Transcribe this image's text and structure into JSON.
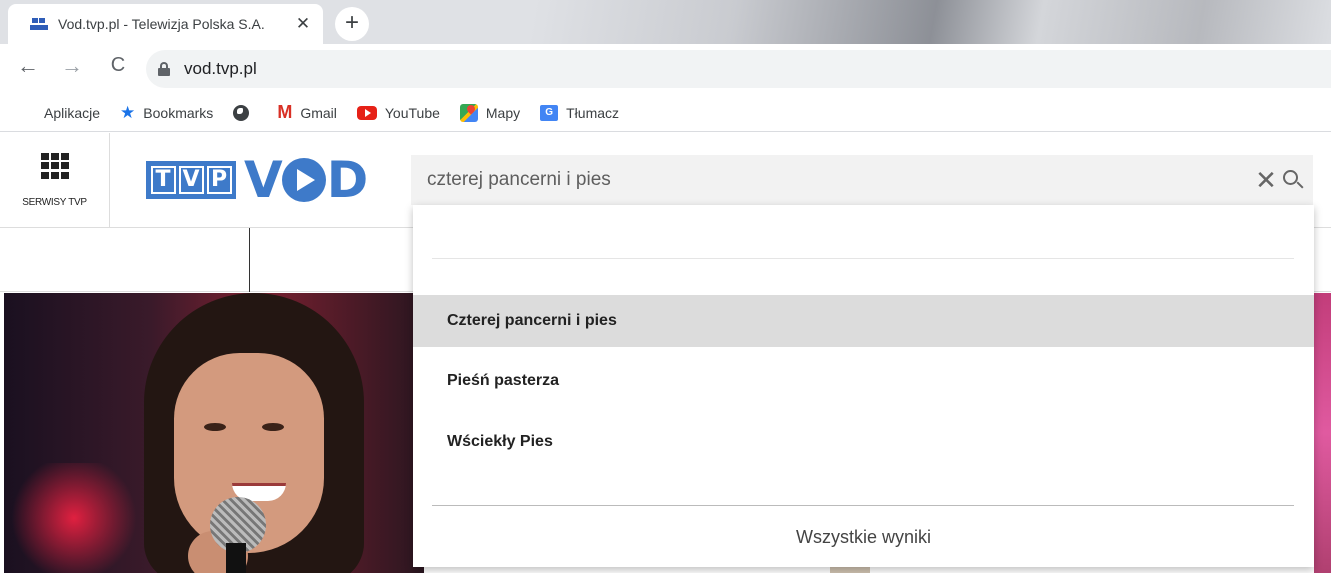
{
  "browser": {
    "tab": {
      "title": "Vod.tvp.pl - Telewizja Polska S.A.",
      "close_glyph": "✕"
    },
    "new_tab_glyph": "+",
    "nav": {
      "back_glyph": "←",
      "forward_glyph": "→",
      "reload_glyph": "C"
    },
    "url": "vod.tvp.pl",
    "bookmarks": [
      {
        "label": "Aplikacje",
        "icon": "apps-grid-icon"
      },
      {
        "label": "Bookmarks",
        "icon": "star-icon"
      },
      {
        "label": "",
        "icon": "globe-icon"
      },
      {
        "label": "Gmail",
        "icon": "gmail-icon"
      },
      {
        "label": "YouTube",
        "icon": "youtube-icon"
      },
      {
        "label": "Mapy",
        "icon": "maps-icon"
      },
      {
        "label": "Tłumacz",
        "icon": "translate-icon"
      }
    ]
  },
  "site": {
    "services_label": "SERWISY TVP",
    "logo": {
      "tvp_letters": [
        "T",
        "V",
        "P"
      ],
      "vod_v": "V",
      "vod_d": "D"
    },
    "colors": {
      "brand_blue": "#3e7ac9",
      "active_row": "#dcdcdc"
    },
    "search": {
      "query": "czterej pancerni i pies",
      "clear_glyph": "✕",
      "suggestions": [
        {
          "label": "Czterej pancerni i pies",
          "active": true
        },
        {
          "label": "Pieśń pasterza",
          "active": false
        },
        {
          "label": "Wściekły Pies",
          "active": false
        }
      ],
      "all_results_label": "Wszystkie wyniki"
    }
  }
}
